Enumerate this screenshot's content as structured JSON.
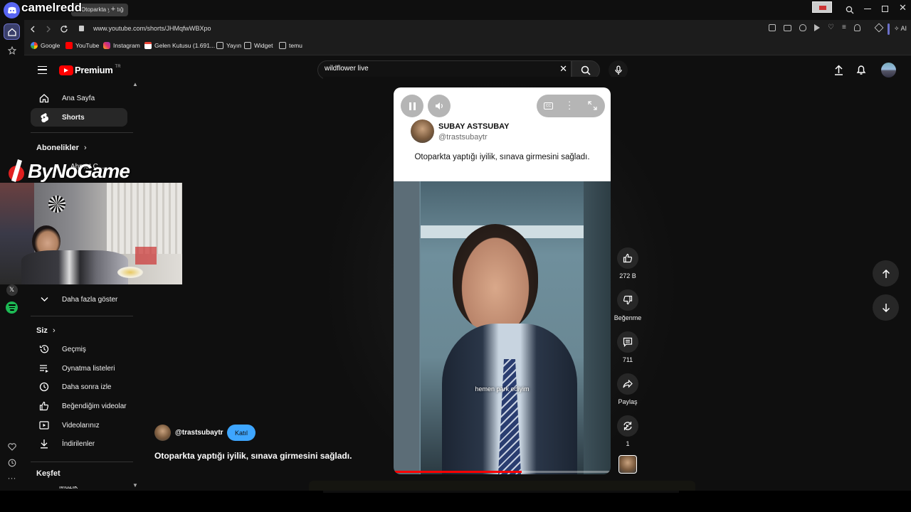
{
  "overlay": {
    "streamer_name": "camelredd",
    "watermark": "ByNoGame"
  },
  "browser": {
    "tab_title": "Otoparkta yaptığı iyilik",
    "url": "www.youtube.com/shorts/JHMqfwWBXpo",
    "ai_label": "AI",
    "bookmarks": [
      "Google",
      "YouTube",
      "Instagram",
      "Gelen Kutusu (1.691...",
      "Yayın",
      "Widget",
      "temu"
    ]
  },
  "youtube": {
    "logo_text": "Premium",
    "logo_region": "TR",
    "search_value": "wildflower live",
    "sidebar": {
      "main": [
        "Ana Sayfa",
        "Shorts"
      ],
      "subscriptions_heading": "Abonelikler",
      "subscription_partial": "Ahmet C...",
      "show_more": "Daha fazla göster",
      "you_heading": "Siz",
      "you_items": [
        "Geçmiş",
        "Oynatma listeleri",
        "Daha sonra izle",
        "Beğendiğim videolar",
        "Videolarınız",
        "İndirilenler"
      ],
      "explore_heading": "Keşfet",
      "explore_partial": "Müzik"
    },
    "short": {
      "card_name": "SUBAY ASTSUBAY",
      "card_handle": "@trastsubaytr",
      "card_text": "Otoparkta yaptığı iyilik, sınava girmesini sağladı.",
      "subtitle": "hemen park ediyim",
      "progress": 0.59,
      "channel_handle": "@trastsubaytr",
      "join_label": "Katıl",
      "title": "Otoparkta yaptığı iyilik, sınava girmesini sağladı."
    },
    "actions": {
      "like_count": "272 B",
      "dislike_label": "Beğenme",
      "comment_count": "711",
      "share_label": "Paylaş",
      "remix_count": "1"
    }
  }
}
